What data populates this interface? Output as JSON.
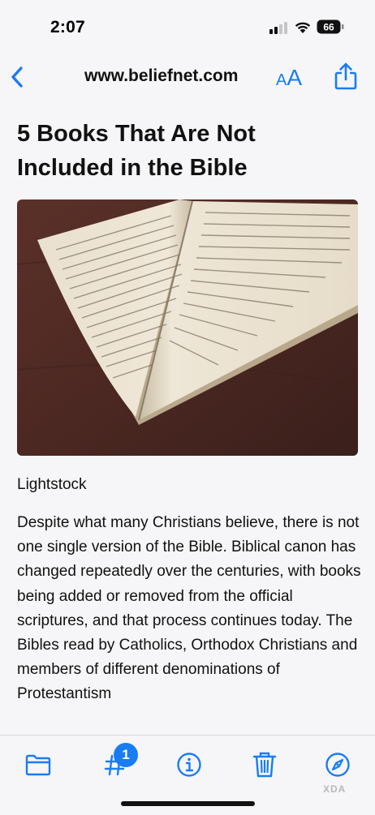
{
  "status_bar": {
    "time": "2:07",
    "battery_level": "66"
  },
  "nav": {
    "domain": "www.beliefnet.com",
    "text_size_small": "A",
    "text_size_large": "A"
  },
  "article": {
    "title": "5 Books That Are Not Included in the Bible",
    "image_caption": "Lightstock",
    "body": "Despite what many Christians believe, there is not one single version of the Bible. Biblical canon has changed repeatedly over the centuries, with books being added or removed from the official scriptures, and that process continues today. The Bibles read by Catholics, Orthodox Christians and members of different denominations of Protestantism"
  },
  "toolbar": {
    "tabs_badge": "1"
  },
  "watermark": "XDA",
  "colors": {
    "accent": "#1a7cf3",
    "background": "#f6f6f8",
    "table": "#4a2a24"
  }
}
